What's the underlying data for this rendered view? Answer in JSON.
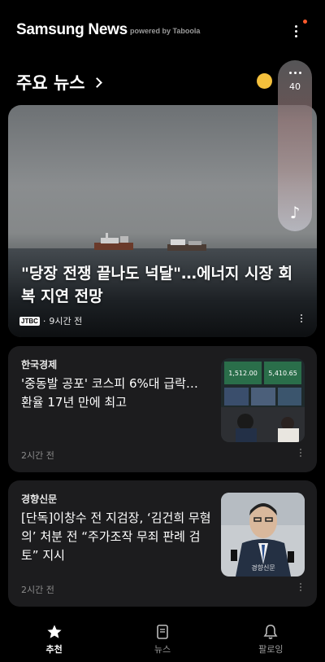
{
  "header": {
    "brand": "Samsung News",
    "powered_by": "powered by Taboola",
    "menu_icon": "more-vert-icon",
    "has_notification": true
  },
  "section": {
    "title": "주요 뉴스"
  },
  "music_widget": {
    "count": "40",
    "icon": "music-note-icon"
  },
  "hero": {
    "title": "\"당장 전쟁 끝나도 넉달\"…에너지 시장 회복 지연 전망",
    "source_logo": "JTBC",
    "time": "9시간 전"
  },
  "cards": [
    {
      "source": "한국경제",
      "title": "'중동발 공포' 코스피 6%대 급락… 환율 17년 만에 최고",
      "time": "2시간 전",
      "thumb_labels": [
        "1,512.00",
        "5,410.65"
      ]
    },
    {
      "source": "경향신문",
      "title": "[단독]이창수 전 지검장, ‘김건희 무혐의’ 처분 전 “주가조작 무죄 판례 검토” 지시",
      "time": "2시간 전",
      "thumb_watermark": "경향신문"
    }
  ],
  "nav": [
    {
      "label": "추천",
      "icon": "star-icon",
      "active": true
    },
    {
      "label": "뉴스",
      "icon": "news-icon",
      "active": false
    },
    {
      "label": "팔로잉",
      "icon": "bell-icon",
      "active": false
    }
  ],
  "colors": {
    "background": "#000000",
    "card": "#1c1c1e",
    "accent_dot": "#ff5a2c",
    "weather": "#f4c03c"
  }
}
